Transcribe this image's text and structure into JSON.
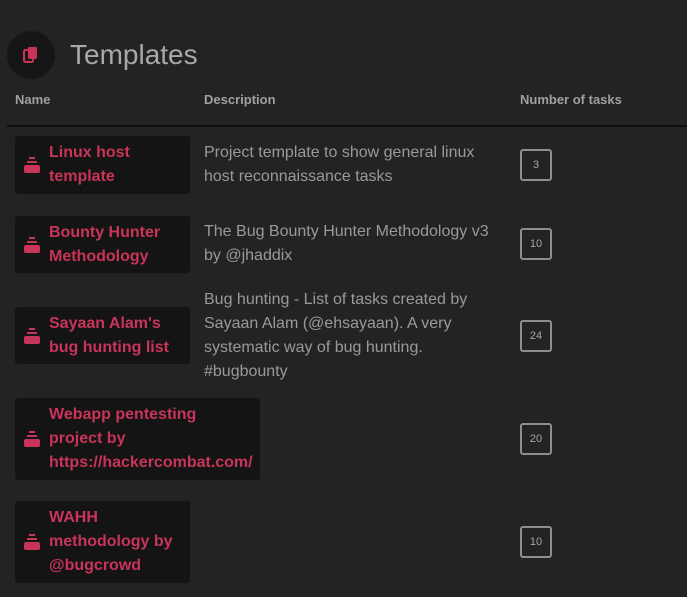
{
  "header": {
    "title": "Templates",
    "icon": "copy-icon",
    "accent": "#c9345a"
  },
  "table": {
    "columns": [
      "Name",
      "Description",
      "Number of tasks"
    ],
    "rows": [
      {
        "name": "Linux host template",
        "description": "Project template to show general linux host reconnaissance tasks",
        "tasks": "3"
      },
      {
        "name": "Bounty Hunter Methodology",
        "description": "The Bug Bounty Hunter Methodology v3 by @jhaddix",
        "tasks": "10"
      },
      {
        "name": "Sayaan Alam's bug hunting list",
        "description": "Bug hunting - List of tasks created by Sayaan Alam (@ehsayaan). A very systematic way of bug hunting. #bugbounty",
        "tasks": "24"
      },
      {
        "name": "Webapp pentesting project by https://hackercombat.com/",
        "description": "",
        "tasks": "20"
      },
      {
        "name": "WAHH methodology by @bugcrowd",
        "description": "",
        "tasks": "10"
      }
    ],
    "row_icon": "stack-icon"
  }
}
